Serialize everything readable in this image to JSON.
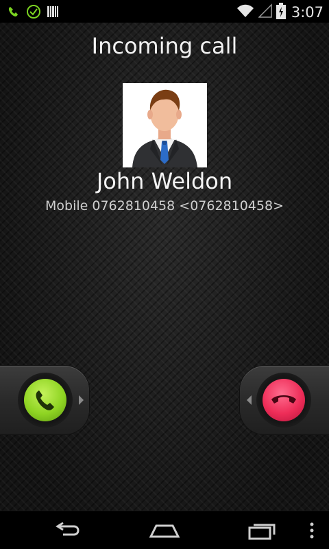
{
  "status_bar": {
    "time": "3:07",
    "left_icons": [
      "call-in-progress-icon",
      "check-circle-icon",
      "barcode-icon"
    ],
    "right_icons": [
      "wifi-icon",
      "signal-icon",
      "battery-charging-icon"
    ]
  },
  "call": {
    "title": "Incoming call",
    "caller_name": "John Weldon",
    "caller_detail": "Mobile 0762810458 <0762810458>"
  },
  "actions": {
    "answer_icon": "phone-answer-icon",
    "decline_icon": "phone-hangup-icon"
  },
  "nav_bar": {
    "buttons": [
      "back-icon",
      "home-icon",
      "recent-apps-icon",
      "menu-icon"
    ]
  },
  "colors": {
    "answer": "#8fd423",
    "decline": "#ee2d58",
    "background": "#1a1a1a"
  }
}
